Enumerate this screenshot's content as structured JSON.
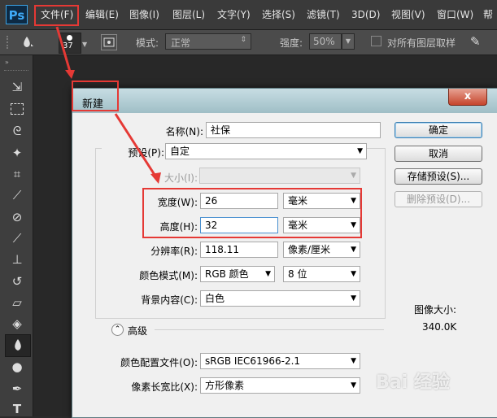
{
  "app": {
    "logo": "Ps"
  },
  "menu": [
    {
      "label": "文件(F)"
    },
    {
      "label": "编辑(E)"
    },
    {
      "label": "图像(I)"
    },
    {
      "label": "图层(L)"
    },
    {
      "label": "文字(Y)"
    },
    {
      "label": "选择(S)"
    },
    {
      "label": "滤镜(T)"
    },
    {
      "label": "3D(D)"
    },
    {
      "label": "视图(V)"
    },
    {
      "label": "窗口(W)"
    },
    {
      "label": "帮"
    }
  ],
  "options": {
    "brush_size": "37",
    "mode_label": "模式:",
    "mode_value": "正常",
    "strength_label": "强度:",
    "strength_value": "50%",
    "sample_all_label": "对所有图层取样"
  },
  "dialog": {
    "title": "新建",
    "close": "x",
    "name_label": "名称(N):",
    "name_value": "社保",
    "preset_label": "预设(P):",
    "preset_value": "自定",
    "size_label": "大小(I):",
    "width_label": "宽度(W):",
    "width_value": "26",
    "width_unit": "毫米",
    "height_label": "高度(H):",
    "height_value": "32",
    "height_unit": "毫米",
    "resolution_label": "分辨率(R):",
    "resolution_value": "118.11",
    "resolution_unit": "像素/厘米",
    "color_mode_label": "颜色模式(M):",
    "color_mode_value": "RGB 颜色",
    "bit_depth_value": "8 位",
    "background_label": "背景内容(C):",
    "background_value": "白色",
    "advanced_label": "高级",
    "color_profile_label": "颜色配置文件(O):",
    "color_profile_value": "sRGB IEC61966-2.1",
    "pixel_aspect_label": "像素长宽比(X):",
    "pixel_aspect_value": "方形像素",
    "ok_label": "确定",
    "cancel_label": "取消",
    "save_preset_label": "存储预设(S)...",
    "delete_preset_label": "删除预设(D)...",
    "image_size_label": "图像大小:",
    "image_size_value": "340.0K"
  },
  "watermark": "Bai 经验",
  "colors": {
    "annotation_red": "#e53935",
    "ps_blue": "#3fa9f5"
  }
}
